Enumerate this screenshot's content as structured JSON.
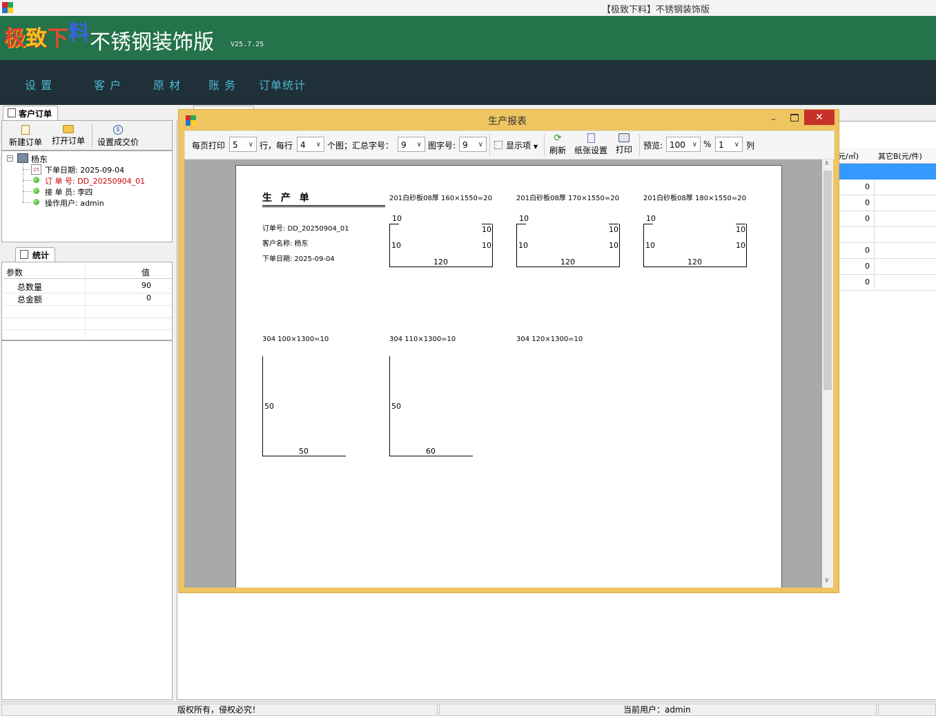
{
  "window": {
    "title": "【极致下料】不锈钢装饰版"
  },
  "header": {
    "logo_chars": [
      "极",
      "致",
      "下",
      "料"
    ],
    "app_name": "不锈钢装饰版",
    "version": "V25.7.25"
  },
  "menu": {
    "items": [
      "设 置",
      "客 户",
      "原 材",
      "账 务",
      "订单统计"
    ]
  },
  "left_panel": {
    "tab_label": "客户订单",
    "toolbar": {
      "new_order": "新建订单",
      "open_order": "打开订单",
      "set_price": "设置成交价"
    },
    "tree": {
      "root": "杨东",
      "order_date": "下单日期: 2025-09-04",
      "order_no": "订 单 号: DD_20250904_01",
      "receiver": "接 单 员: 李四",
      "operator": "操作用户: admin"
    }
  },
  "stats_panel": {
    "tab_label": "统计",
    "col_param": "参数",
    "col_value": "值",
    "rows": [
      {
        "name": "总数量",
        "value": "90"
      },
      {
        "name": "总金额",
        "value": "0"
      }
    ]
  },
  "background_table": {
    "col1": "元/㎡)",
    "col2": "其它B(元/件)",
    "values": [
      "0",
      "0",
      "0",
      "",
      "0",
      "0",
      "0"
    ]
  },
  "dialog": {
    "title": "生产报表",
    "toolbar": {
      "per_page_label": "每页打印",
      "per_page_value": "5",
      "rows_label": "行，每行",
      "per_row_value": "4",
      "summary_label": "个图；汇总字号：",
      "summary_font": "9",
      "figure_font_label": "图字号:",
      "figure_font": "9",
      "display_label": "显示项",
      "refresh": "刷新",
      "paper_setup": "纸张设置",
      "print": "打印",
      "preview_label": "预览:",
      "zoom_value": "100",
      "percent": "%",
      "cols_value": "1",
      "cols_label": "列"
    },
    "report": {
      "title": "生 产 单",
      "order_no": "订单号: DD_20250904_01",
      "customer": "客户名称: 杨东",
      "date": "下单日期: 2025-09-04",
      "parts": [
        {
          "label": "201白砂板08厚 160×1550=20",
          "top": "10",
          "r1": "10",
          "l": "10",
          "r2": "10",
          "bottom": "120"
        },
        {
          "label": "201白砂板08厚 170×1550=20",
          "top": "10",
          "r1": "10",
          "l": "10",
          "r2": "10",
          "bottom": "120"
        },
        {
          "label": "201白砂板08厚 180×1550=20",
          "top": "10",
          "r1": "10",
          "l": "10",
          "r2": "10",
          "bottom": "120"
        }
      ],
      "angles": [
        {
          "label": "304 100×1300=10",
          "side": "50",
          "bottom": "50"
        },
        {
          "label": "304 110×1300=10",
          "side": "50",
          "bottom": "60"
        },
        {
          "label": "304 120×1300=10"
        }
      ]
    }
  },
  "status": {
    "copyright": "版权所有，侵权必究！",
    "current_user": "当前用户：admin"
  },
  "colors": {
    "header_green": "#24734a",
    "menu_dark": "#1f3038",
    "menu_text": "#4bb7cf",
    "dialog_border": "#efc561"
  }
}
